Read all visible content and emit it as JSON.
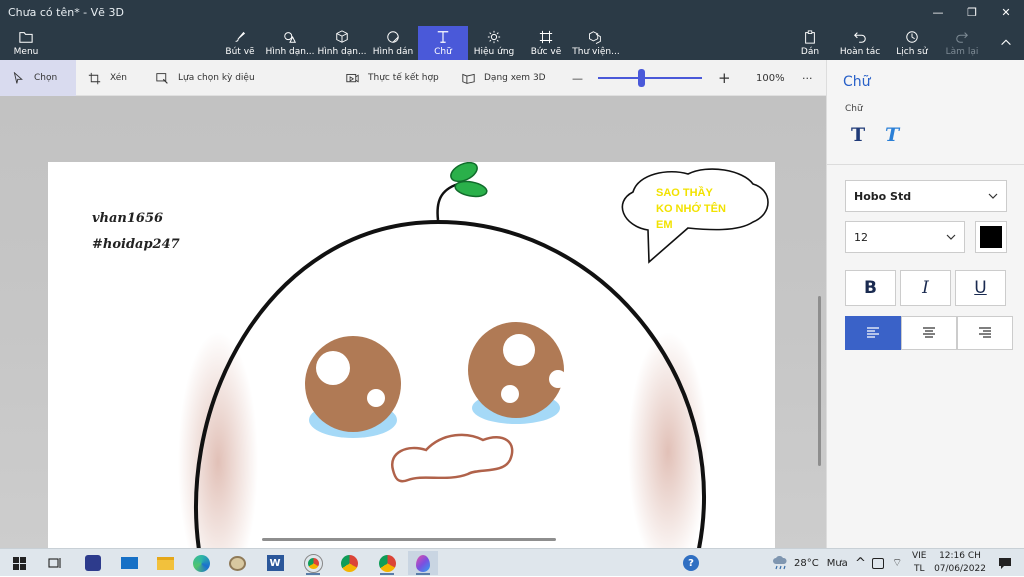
{
  "window": {
    "title": "Chưa có tên* - Vẽ 3D",
    "minimize": "—",
    "maximize": "❐",
    "close": "✕"
  },
  "ribbon": {
    "menu": "Menu",
    "tools": [
      {
        "label": "Bút vẽ",
        "icon": "brush-icon"
      },
      {
        "label": "Hình dạn...",
        "icon": "2d-shapes-icon"
      },
      {
        "label": "Hình dạn...",
        "icon": "3d-shapes-icon"
      },
      {
        "label": "Hình dán",
        "icon": "stickers-icon"
      },
      {
        "label": "Chữ",
        "icon": "text-icon"
      },
      {
        "label": "Hiệu ứng",
        "icon": "effects-icon"
      },
      {
        "label": "Bức vẽ",
        "icon": "canvas-icon"
      },
      {
        "label": "Thư viện...",
        "icon": "3d-library-icon"
      }
    ],
    "right": [
      {
        "label": "Dán",
        "icon": "paste-icon"
      },
      {
        "label": "Hoàn tác",
        "icon": "undo-icon"
      },
      {
        "label": "Lịch sử",
        "icon": "history-icon"
      },
      {
        "label": "Làm lại",
        "icon": "redo-icon"
      }
    ]
  },
  "toolbar": {
    "select": "Chọn",
    "crop": "Xén",
    "magic_select": "Lựa chọn kỳ diệu",
    "mixed_reality": "Thực tế kết hợp",
    "view_3d": "Dạng xem 3D",
    "zoom_minus": "—",
    "zoom_plus": "+",
    "zoom_level": "100%",
    "more": "···",
    "zoom_fraction": 0.42
  },
  "canvas": {
    "handle": "vhan1656",
    "hashtag": "#hoidap247",
    "speech": [
      "SAO THẦY",
      "KO NHỚ TÊN",
      "EM"
    ]
  },
  "panel": {
    "title": "Chữ",
    "subtitle": "Chữ",
    "font": "Hobo Std",
    "size": "12",
    "color": "#000000",
    "bold": "B",
    "italic": "I",
    "underline": "U"
  },
  "taskbar": {
    "temperature": "28°C",
    "weather": "Mưa",
    "lang_top": "VIE",
    "lang_bottom": "TL",
    "time": "12:16 CH",
    "date": "07/06/2022",
    "chevron": "^"
  },
  "colors": {
    "ribbon": "#2b3a46",
    "accent": "#4a59d9",
    "panel_title": "#2860c8"
  }
}
